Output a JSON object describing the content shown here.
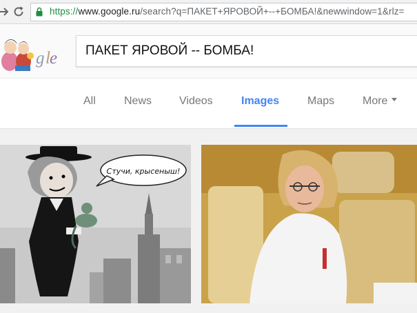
{
  "browser": {
    "back_icon": "arrow-left-icon",
    "forward_icon": "arrow-right-icon",
    "reload_icon": "reload-icon",
    "url_scheme": "https://",
    "url_host": "www.google.ru",
    "url_path": "/search?q=ПАКЕТ+ЯРОВОЙ+--+БОМБА!&newwindow=1&rlz="
  },
  "google": {
    "logo_text": "Google",
    "search_query": "ПАКЕТ ЯРОВОЙ -- БОМБА!"
  },
  "tabs": [
    {
      "label": "All",
      "active": false
    },
    {
      "label": "News",
      "active": false
    },
    {
      "label": "Videos",
      "active": false
    },
    {
      "label": "Images",
      "active": true
    },
    {
      "label": "Maps",
      "active": false
    },
    {
      "label": "More",
      "active": false
    }
  ],
  "results": {
    "cartoon_caption": "Стучи, крысеныш!"
  },
  "colors": {
    "accent": "#4285f4",
    "tab_text": "#777777",
    "secure_green": "#1e8e3e"
  }
}
